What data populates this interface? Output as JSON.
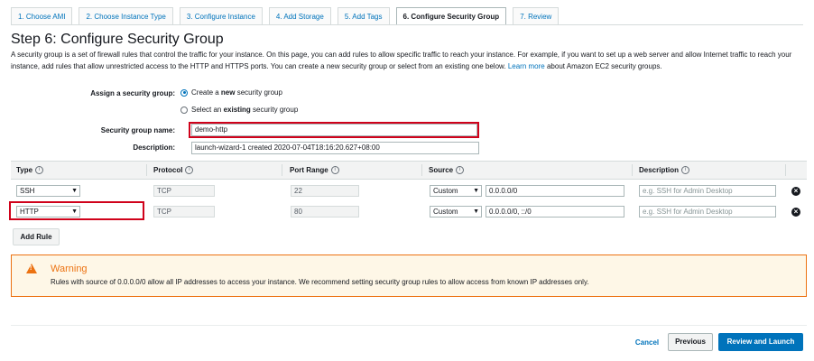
{
  "tabs": [
    {
      "label": "1. Choose AMI"
    },
    {
      "label": "2. Choose Instance Type"
    },
    {
      "label": "3. Configure Instance"
    },
    {
      "label": "4. Add Storage"
    },
    {
      "label": "5. Add Tags"
    },
    {
      "label": "6. Configure Security Group",
      "active": true
    },
    {
      "label": "7. Review"
    }
  ],
  "page": {
    "title": "Step 6: Configure Security Group",
    "intro": "A security group is a set of firewall rules that control the traffic for your instance. On this page, you can add rules to allow specific traffic to reach your instance. For example, if you want to set up a web server and allow Internet traffic to reach your instance, add rules that allow unrestricted access to the HTTP and HTTPS ports. You can create a new security group or select from an existing one below.",
    "learn_more": "Learn more",
    "intro_tail": "about Amazon EC2 security groups."
  },
  "form": {
    "assign_label": "Assign a security group:",
    "option_create_pre": "Create a ",
    "option_create_bold": "new",
    "option_create_post": " security group",
    "option_existing_pre": "Select an ",
    "option_existing_bold": "existing",
    "option_existing_post": " security group",
    "name_label": "Security group name:",
    "name_value": "demo-http",
    "desc_label": "Description:",
    "desc_value": "launch-wizard-1 created 2020-07-04T18:16:20.627+08:00"
  },
  "table": {
    "columns": [
      "Type",
      "Protocol",
      "Port Range",
      "Source",
      "Description"
    ],
    "rows": [
      {
        "type": "SSH",
        "protocol": "TCP",
        "port": "22",
        "source_mode": "Custom",
        "source": "0.0.0.0/0",
        "desc_placeholder": "e.g. SSH for Admin Desktop"
      },
      {
        "type": "HTTP",
        "protocol": "TCP",
        "port": "80",
        "source_mode": "Custom",
        "source": "0.0.0.0/0, ::/0",
        "desc_placeholder": "e.g. SSH for Admin Desktop"
      }
    ],
    "add_rule": "Add Rule"
  },
  "warning": {
    "title": "Warning",
    "text": "Rules with source of 0.0.0.0/0 allow all IP addresses to access your instance. We recommend setting security group rules to allow access from known IP addresses only."
  },
  "footer": {
    "cancel": "Cancel",
    "previous": "Previous",
    "launch": "Review and Launch"
  },
  "colors": {
    "link": "#0073bb",
    "warning": "#ec7211",
    "highlight": "#d0021b"
  },
  "icons": {
    "info": "info-icon",
    "remove": "remove-rule-icon",
    "warning": "warning-icon"
  }
}
